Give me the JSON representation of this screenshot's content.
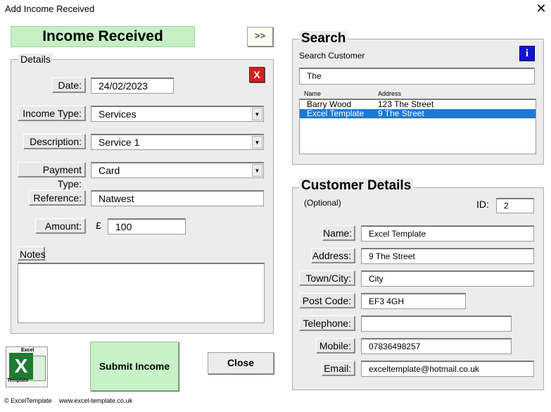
{
  "window": {
    "title": "Add Income Received",
    "close_glyph": "✕"
  },
  "header": {
    "banner": "Income Received",
    "expand_label": ">>"
  },
  "details": {
    "legend": "Details",
    "delete_glyph": "X",
    "date_label": "Date:",
    "date_value": "24/02/2023",
    "income_type_label": "Income Type:",
    "income_type_value": "Services",
    "description_label": "Description:",
    "description_value": "Service 1",
    "payment_type_label": "Payment Type:",
    "payment_type_value": "Card",
    "reference_label": "Reference:",
    "reference_value": "Natwest",
    "amount_label": "Amount:",
    "currency_symbol": "£",
    "amount_value": "100",
    "notes_label": "Notes",
    "notes_value": ""
  },
  "actions": {
    "submit_label": "Submit Income",
    "close_label": "Close"
  },
  "search": {
    "legend": "Search",
    "search_label": "Search Customer",
    "info_glyph": "i",
    "search_value": "The",
    "columns": [
      "Name",
      "Address"
    ],
    "rows": [
      {
        "name": "Barry Wood",
        "address": "123 The Street",
        "selected": false
      },
      {
        "name": "Excel Template",
        "address": "9 The Street",
        "selected": true
      }
    ]
  },
  "customer": {
    "legend": "Customer Details",
    "optional_label": "(Optional)",
    "id_label": "ID:",
    "id_value": "2",
    "name_label": "Name:",
    "name_value": "Excel Template",
    "address_label": "Address:",
    "address_value": "9 The Street",
    "town_label": "Town/City:",
    "town_value": "City",
    "postcode_label": "Post Code:",
    "postcode_value": "EF3 4GH",
    "telephone_label": "Telephone:",
    "telephone_value": "",
    "mobile_label": "Mobile:",
    "mobile_value": "07836498257",
    "email_label": "Email:",
    "email_value": "exceltemplate@hotmail.co.uk"
  },
  "footer": {
    "logo_text_top": "Excel",
    "logo_letter": "X",
    "logo_text_bottom": "Template",
    "copyright": "© ExcelTemplate",
    "website": "www.excel-template.co.uk"
  },
  "icons": {
    "close": "close-icon",
    "expand": "expand-icon",
    "delete": "delete-icon",
    "info": "info-icon",
    "dropdown": "chevron-down-icon",
    "logo": "excel-template-logo"
  }
}
